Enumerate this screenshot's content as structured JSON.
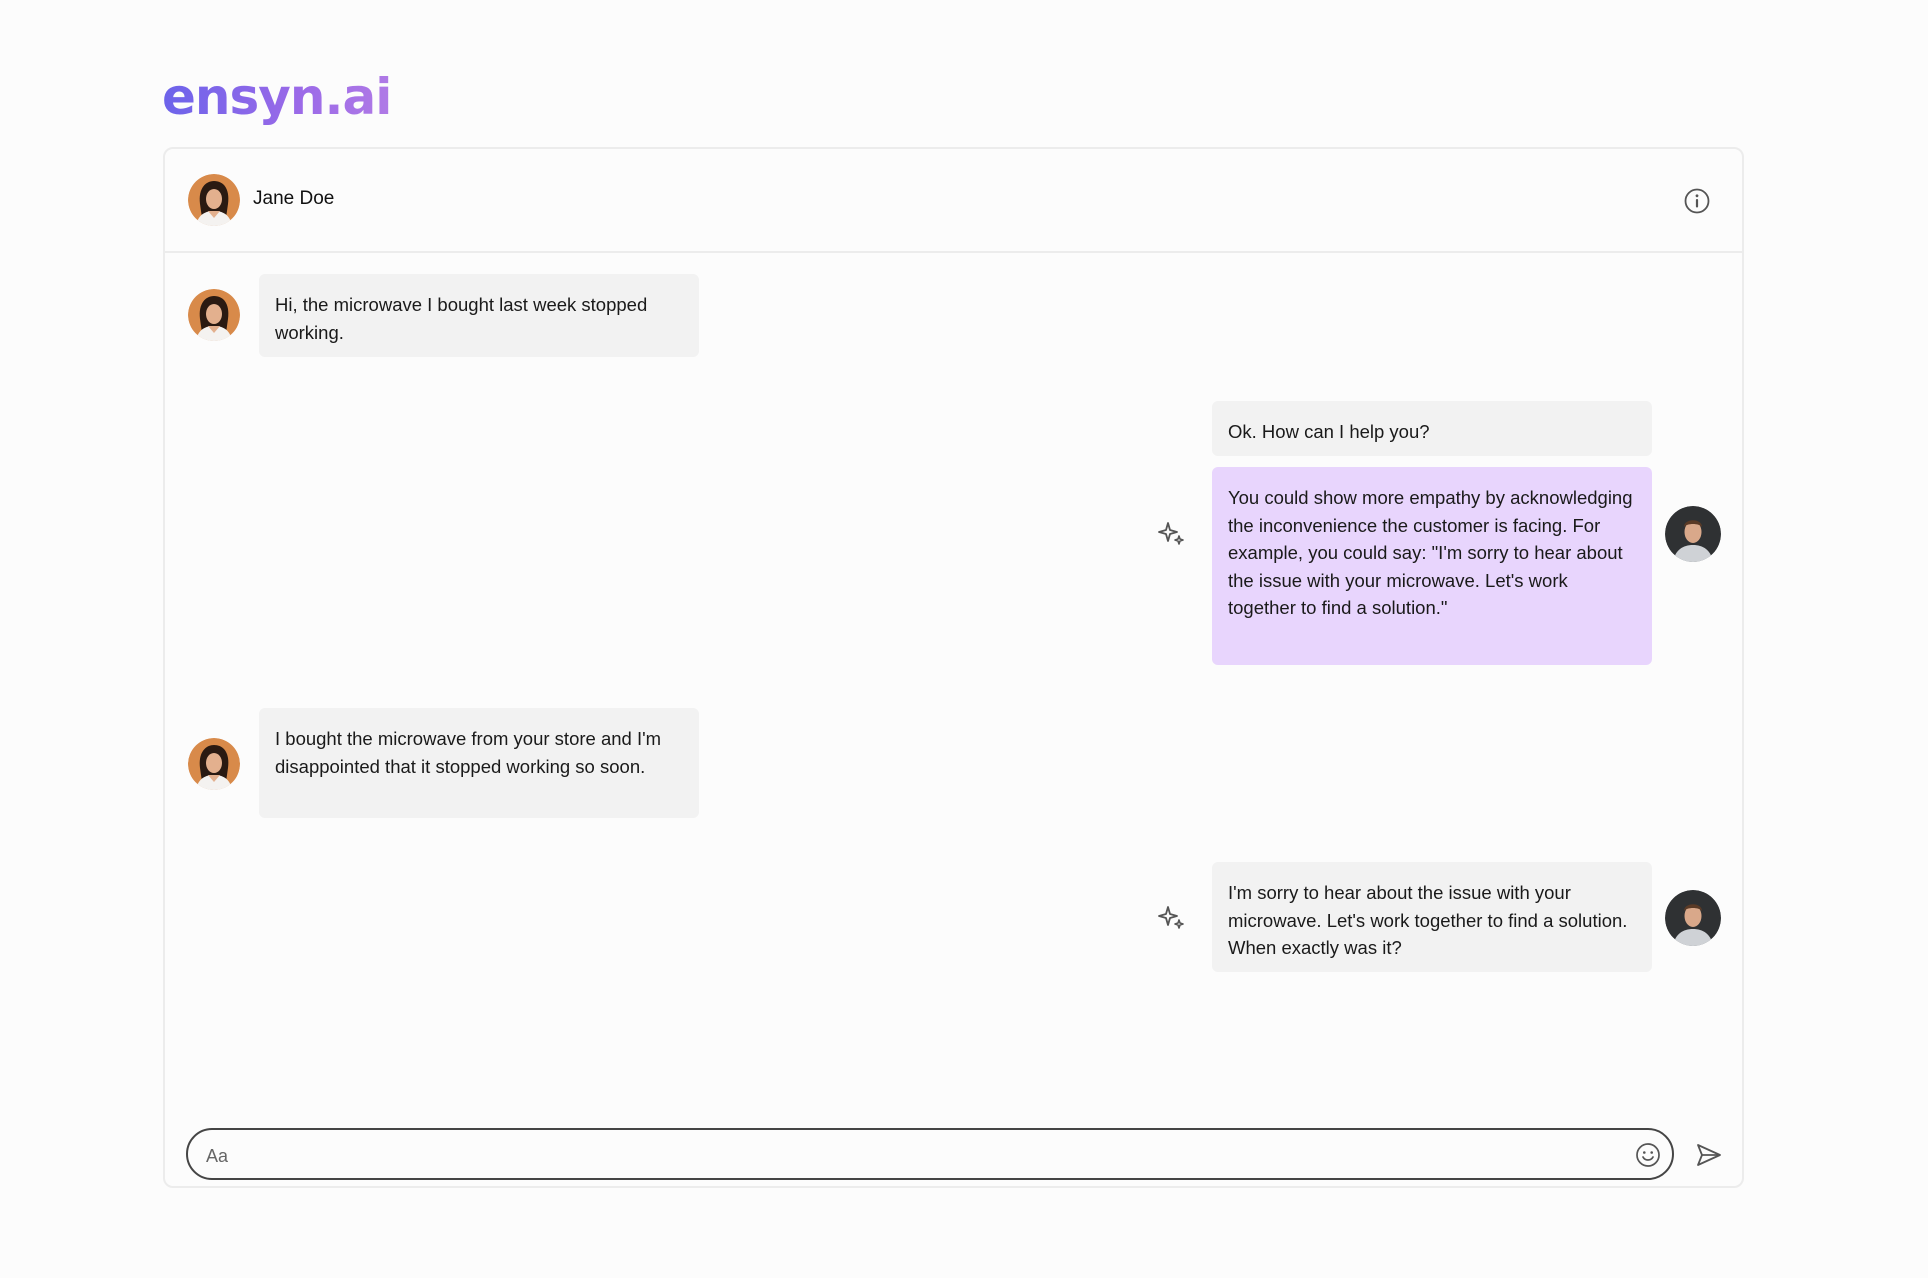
{
  "brand": {
    "logo_text": "ensyn.ai"
  },
  "contact": {
    "name": "Jane Doe"
  },
  "messages": [
    {
      "sender": "customer",
      "text": "Hi, the microwave I bought last week stopped working."
    },
    {
      "sender": "agent",
      "text": "Ok. How can I help you?"
    },
    {
      "sender": "ai-suggestion",
      "text": "You could show more empathy by acknowledging the inconvenience the customer is facing. For example, you could say: \"I'm sorry to hear about the issue with your microwave. Let's work together to find a solution.\""
    },
    {
      "sender": "customer",
      "text": "I bought the microwave from your store and I'm disappointed that it stopped working so soon."
    },
    {
      "sender": "agent",
      "text": "I'm sorry to hear about the issue with your microwave. Let's work together to find a solution. When exactly was it?"
    }
  ],
  "composer": {
    "placeholder": "Aa",
    "value": ""
  },
  "colors": {
    "suggestion_bubble": "#e8d5fd",
    "message_bubble": "#f2f2f2",
    "logo_gradient_start": "#6c63ea",
    "logo_gradient_end": "#b07ae6"
  },
  "icons": {
    "info": "info-icon",
    "sparkle": "sparkle-icon",
    "emoji": "emoji-icon",
    "send": "send-icon"
  }
}
